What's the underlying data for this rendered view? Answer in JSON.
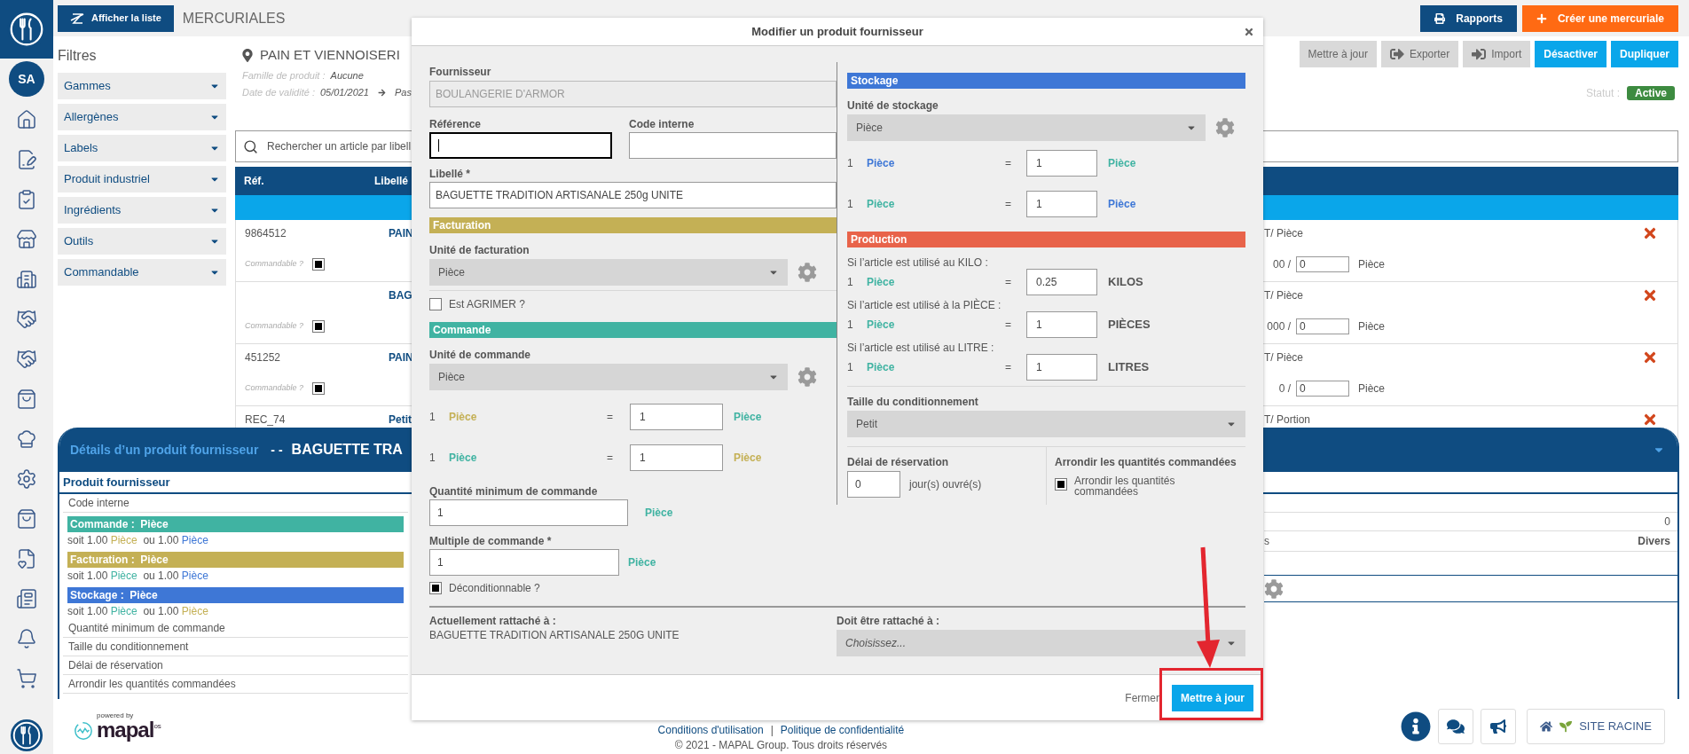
{
  "header": {
    "list_button": "Afficher la liste",
    "title": "MERCURIALES",
    "actions": [
      {
        "label": "Rapports",
        "kind": "report"
      },
      {
        "label": "Créer une mercuriale",
        "kind": "create"
      }
    ]
  },
  "filters": {
    "title": "Filtres",
    "items": [
      "Gammes",
      "Allergènes",
      "Labels",
      "Produit industriel",
      "Ingrédients",
      "Outils",
      "Commandable"
    ]
  },
  "mercuriale": {
    "name": "PAIN ET VIENNOISERI",
    "family_label": "Famille de produit :",
    "family": "Aucune",
    "date_label": "Date de validité :",
    "date": "05/01/2021",
    "date_end": "Pas"
  },
  "toolbar": [
    {
      "label": "Mettre à jour",
      "kind": "neutral"
    },
    {
      "label": "Exporter",
      "kind": "export"
    },
    {
      "label": "Import",
      "kind": "import"
    },
    {
      "label": "Désactiver",
      "kind": "primary"
    },
    {
      "label": "Dupliquer",
      "kind": "primary"
    }
  ],
  "status": {
    "label": "Statut :",
    "value": "Active"
  },
  "search": {
    "placeholder": "Rechercher un article par libell"
  },
  "table": {
    "columns": [
      "Réf.",
      "Libellé"
    ],
    "rows": [
      {
        "ref": "9864512",
        "label": "PAIN",
        "commandable_label": "Commandable ?",
        "commandable": true,
        "price": "T/ Pièce",
        "qty_prefix": "00 /",
        "qty": "0",
        "qty_unit": "Pièce"
      },
      {
        "label": "BAG",
        "commandable_label": "Commandable ?",
        "commandable": true,
        "price": "T/ Pièce",
        "qty_prefix": "000 /",
        "qty": "0",
        "qty_unit": "Pièce"
      },
      {
        "ref": "451252",
        "label": "PAIN",
        "commandable_label": "Commandable ?",
        "commandable": true,
        "price": "T/ Pièce",
        "qty_prefix": "0 /",
        "qty": "0",
        "qty_unit": "Pièce"
      },
      {
        "ref": "REC_74",
        "label": "Petit",
        "price": "T/ Portion"
      }
    ]
  },
  "details_panel": {
    "title": "Détails d’un produit fournisseur",
    "separator": "- -",
    "product": "BAGUETTE TRA",
    "section": "Produit fournisseur",
    "rows": [
      {
        "kind": "plain",
        "label": "Code interne"
      },
      {
        "kind": "unit",
        "color": "#40b3a2",
        "label": "Commande :",
        "unit": "Pièce",
        "prefix": "soit 1.00",
        "unit1": {
          "text": "Pièce",
          "color": "#c4b055"
        },
        "middle": "ou 1.00",
        "unit2": {
          "text": "Pièce",
          "color": "#3e77d6"
        }
      },
      {
        "kind": "unit",
        "color": "#c4b055",
        "label": "Facturation :",
        "unit": "Pièce",
        "prefix": "soit 1.00",
        "unit1": {
          "text": "Pièce",
          "color": "#40b3a2"
        },
        "middle": "ou 1.00",
        "unit2": {
          "text": "Pièce",
          "color": "#3e77d6"
        }
      },
      {
        "kind": "unit",
        "color": "#3e77d6",
        "label": "Stockage :",
        "unit": "Pièce",
        "prefix": "soit 1.00",
        "unit1": {
          "text": "Pièce",
          "color": "#40b3a2"
        },
        "middle": "ou 1.00",
        "unit2": {
          "text": "Pièce",
          "color": "#c4b055"
        }
      },
      {
        "kind": "plain",
        "label": "Quantité minimum de commande"
      },
      {
        "kind": "plain",
        "label": "Taille du conditionnement"
      },
      {
        "kind": "plain",
        "label": "Délai de réservation"
      },
      {
        "kind": "plain",
        "label": "Arrondir les quantités commandées"
      }
    ],
    "right_rows": [
      {
        "value": "0"
      },
      {
        "label": "s",
        "value": "Divers"
      }
    ]
  },
  "modal": {
    "title": "Modifier un produit fournisseur",
    "supplier": {
      "label": "Fournisseur",
      "value": "BOULANGERIE D'ARMOR",
      "disabled": true
    },
    "reference": {
      "label": "Référence",
      "focused": true
    },
    "internal_code": {
      "label": "Code interne"
    },
    "name": {
      "label": "Libellé *",
      "value": "BAGUETTE TRADITION ARTISANALE 250g UNITE"
    },
    "billing": {
      "color": "#c4b055",
      "title": "Facturation",
      "unit_label": "Unité de facturation",
      "unit": "Pièce",
      "agrimer": {
        "label": "Est AGRIMER ?",
        "checked": false
      }
    },
    "order": {
      "color": "#40b3a2",
      "title": "Commande",
      "unit_label": "Unité de commande",
      "unit": "Pièce",
      "conversions": [
        {
          "qty": "1",
          "from": {
            "text": "Pièce",
            "color": "#c4b055"
          },
          "operator": "=",
          "value": "1",
          "to": {
            "text": "Pièce",
            "color": "#40b3a2"
          }
        },
        {
          "qty": "1",
          "from": {
            "text": "Pièce",
            "color": "#40b3a2"
          },
          "operator": "=",
          "value": "1",
          "to": {
            "text": "Pièce",
            "color": "#c4b055"
          }
        }
      ],
      "min": {
        "label": "Quantité minimum de commande",
        "value": "1",
        "unit": "Pièce"
      },
      "multiple": {
        "label": "Multiple de commande *",
        "value": "1",
        "unit": "Pièce"
      },
      "deconditionnable": {
        "label": "Déconditionnable ?",
        "checked": true
      }
    },
    "storage": {
      "color": "#3e77d6",
      "title": "Stockage",
      "unit_label": "Unité de stockage",
      "unit": "Pièce",
      "conversions": [
        {
          "qty": "1",
          "from": {
            "text": "Pièce",
            "color": "#3e77d6"
          },
          "operator": "=",
          "value": "1",
          "to": {
            "text": "Pièce",
            "color": "#40b3a2"
          }
        },
        {
          "qty": "1",
          "from": {
            "text": "Pièce",
            "color": "#40b3a2"
          },
          "operator": "=",
          "value": "1",
          "to": {
            "text": "Pièce",
            "color": "#3e77d6"
          }
        }
      ]
    },
    "production": {
      "color": "#e8634a",
      "title": "Production",
      "rows": [
        {
          "caption": "Si l’article est utilisé au KILO :",
          "qty": "1",
          "from": {
            "text": "Pièce",
            "color": "#40b3a2"
          },
          "operator": "=",
          "value": "0.25",
          "to": {
            "text": "KILOS"
          }
        },
        {
          "caption": "Si l’article est utilisé à la PIÈCE :",
          "qty": "1",
          "from": {
            "text": "Pièce",
            "color": "#40b3a2"
          },
          "operator": "=",
          "value": "1",
          "to": {
            "text": "PIÈCES"
          }
        },
        {
          "caption": "Si l’article est utilisé au LITRE :",
          "qty": "1",
          "from": {
            "text": "Pièce",
            "color": "#40b3a2"
          },
          "operator": "=",
          "value": "1",
          "to": {
            "text": "LITRES"
          }
        }
      ]
    },
    "package": {
      "label": "Taille du conditionnement",
      "value": "Petit"
    },
    "lead_time": {
      "label": "Délai de réservation",
      "value": "0",
      "unit": "jour(s) ouvré(s)"
    },
    "rounding": {
      "title": "Arrondir les quantités commandées",
      "label": "Arrondir les quantités commandées",
      "checked": true
    },
    "current": {
      "label": "Actuellement rattaché à :",
      "value": "BAGUETTE TRADITION ARTISANALE 250G UNITE"
    },
    "target": {
      "label": "Doit être rattaché à :",
      "placeholder": "Choisissez..."
    },
    "buttons": {
      "close": "Fermer",
      "submit": "Mettre à jour"
    }
  },
  "sidebar": {
    "avatar": "SA"
  },
  "footer": {
    "powered": "powered by",
    "brand": "mapal",
    "brand_suffix": "os",
    "links": [
      "Conditions d'utilisation",
      "Politique de confidentialité"
    ],
    "separator": "|",
    "copyright": "© 2021 - MAPAL Group. Tous droits réservés",
    "site": "SITE RACINE"
  }
}
